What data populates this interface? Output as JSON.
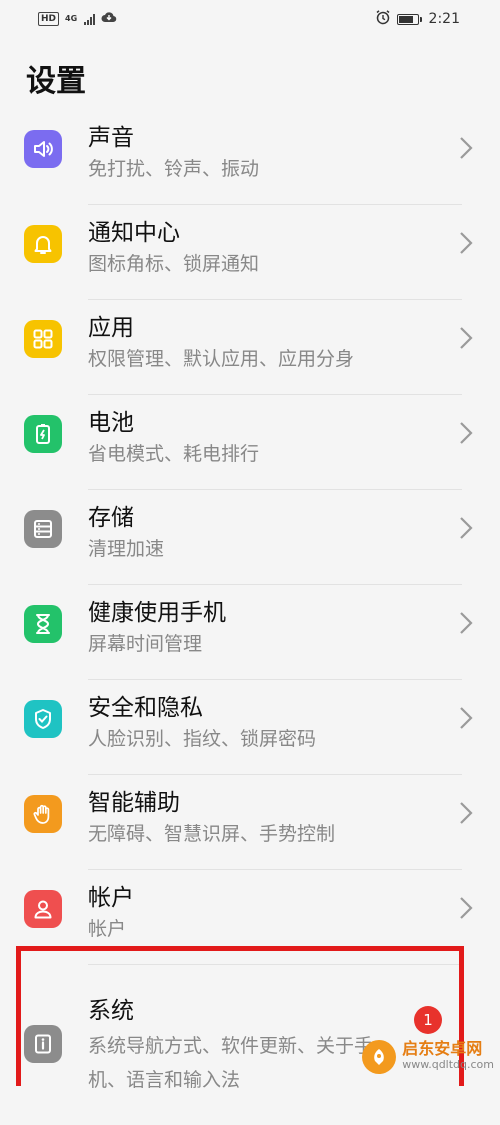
{
  "status_bar": {
    "network_badge": "HD",
    "network_type": "4G",
    "time": "2:21",
    "battery_level": 0.8
  },
  "page": {
    "title": "设置"
  },
  "settings": [
    {
      "id": "sound",
      "label": "声音",
      "sub": "免打扰、铃声、振动",
      "color": "#7b6cf0",
      "icon": "speaker-icon"
    },
    {
      "id": "notification",
      "label": "通知中心",
      "sub": "图标角标、锁屏通知",
      "color": "#f7c300",
      "icon": "bell-icon"
    },
    {
      "id": "apps",
      "label": "应用",
      "sub": "权限管理、默认应用、应用分身",
      "color": "#f7c300",
      "icon": "grid-icon"
    },
    {
      "id": "battery",
      "label": "电池",
      "sub": "省电模式、耗电排行",
      "color": "#23c26a",
      "icon": "battery-icon"
    },
    {
      "id": "storage",
      "label": "存储",
      "sub": "清理加速",
      "color": "#8c8c8c",
      "icon": "storage-icon"
    },
    {
      "id": "digital-health",
      "label": "健康使用手机",
      "sub": "屏幕时间管理",
      "color": "#23c26a",
      "icon": "hourglass-icon"
    },
    {
      "id": "security",
      "label": "安全和隐私",
      "sub": "人脸识别、指纹、锁屏密码",
      "color": "#1fc3c3",
      "icon": "shield-icon"
    },
    {
      "id": "accessibility",
      "label": "智能辅助",
      "sub": "无障碍、智慧识屏、手势控制",
      "color": "#f39a1e",
      "icon": "hand-icon"
    },
    {
      "id": "accounts",
      "label": "帐户",
      "sub": "帐户",
      "color": "#ef4f4f",
      "icon": "person-icon"
    },
    {
      "id": "system",
      "label": "系统",
      "sub": "系统导航方式、软件更新、关于手机、语言和输入法",
      "color": "#8c8c8c",
      "icon": "info-icon"
    }
  ],
  "system_badge": "1",
  "watermark": {
    "title": "启东安卓网",
    "url": "www.qdltdq.com"
  }
}
